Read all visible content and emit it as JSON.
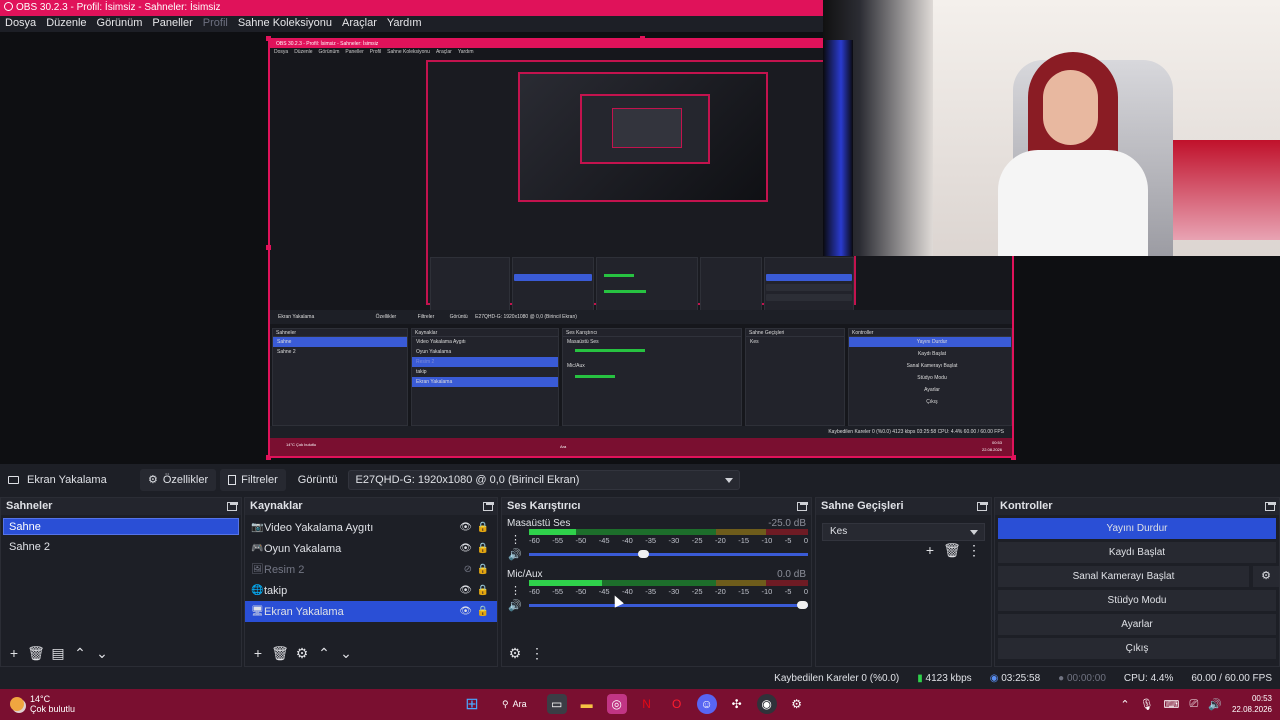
{
  "window": {
    "title": "OBS 30.2.3 - Profil: İsimsiz - Sahneler: İsimsiz"
  },
  "menu": [
    "Dosya",
    "Düzenle",
    "Görünüm",
    "Paneller",
    "Profil",
    "Sahne Koleksiyonu",
    "Araçlar",
    "Yardım"
  ],
  "nested": {
    "title": "OBS 30.2.3 - Profil: İsimsiz - Sahneler: İsimsiz",
    "source_name": "Ekran Yakalama",
    "props": "Özellikler",
    "filters": "Filtreler",
    "display_label": "Görüntü",
    "display_value": "E27QHD-G: 1920x1080 @ 0,0 (Birincil Ekran)",
    "scenes_head": "Sahneler",
    "scenes": [
      "Sahne",
      "Sahne 2"
    ],
    "sources_head": "Kaynaklar",
    "sources": [
      "Video Yakalama Aygıtı",
      "Oyun Yakalama",
      "Resim 2",
      "takip",
      "Ekran Yakalama"
    ],
    "mixer_head": "Ses Karıştırıcı",
    "mixer_ch1": "Masaüstü Ses",
    "mixer_ch1_db": "-25.0 dB",
    "mixer_ch2": "Mic/Aux",
    "mixer_ch2_db": "0.0 dB",
    "trans_head": "Sahne Geçişleri",
    "trans_value": "Kes",
    "ctrl_head": "Kontroller",
    "ctrls": [
      "Yayını Durdur",
      "Kaydı Başlat",
      "Sanal Kamerayı Başlat",
      "Stüdyo Modu",
      "Ayarlar",
      "Çıkış"
    ],
    "status": "Kaybedilen Kareler 0 (%0.0)   4123 kbps   03:25:58   CPU: 4.4%   60.00 / 60.00 FPS",
    "weather": "14°C Çok bulutlu",
    "search": "Ara",
    "clock": "00:53",
    "date": "22.08.2026"
  },
  "source_toolbar": {
    "source_name": "Ekran Yakalama",
    "properties_label": "Özellikler",
    "filters_label": "Filtreler",
    "display_label": "Görüntü",
    "display_value": "E27QHD-G: 1920x1080 @ 0,0 (Birincil Ekran)"
  },
  "scenes": {
    "title": "Sahneler",
    "items": [
      "Sahne",
      "Sahne 2"
    ],
    "selected": 0
  },
  "sources": {
    "title": "Kaynaklar",
    "items": [
      {
        "label": "Video Yakalama Aygıtı",
        "icon": "camera-icon",
        "visible": true,
        "selected": false
      },
      {
        "label": "Oyun Yakalama",
        "icon": "gamepad-icon",
        "visible": true,
        "selected": false
      },
      {
        "label": "Resim 2",
        "icon": "image-icon",
        "visible": false,
        "selected": false
      },
      {
        "label": "takip",
        "icon": "globe-icon",
        "visible": true,
        "selected": false
      },
      {
        "label": "Ekran Yakalama",
        "icon": "monitor-icon",
        "visible": true,
        "selected": true
      }
    ]
  },
  "mixer": {
    "title": "Ses Karıştırıcı",
    "scale": [
      "-60",
      "-55",
      "-50",
      "-45",
      "-40",
      "-35",
      "-30",
      "-25",
      "-20",
      "-15",
      "-10",
      "-5",
      "0"
    ],
    "channels": [
      {
        "name": "Masaüstü Ses",
        "db": "-25.0 dB",
        "level": 0.17,
        "volume": 0.43
      },
      {
        "name": "Mic/Aux",
        "db": "0.0 dB",
        "level": 0.26,
        "volume": 1.0
      }
    ]
  },
  "transitions": {
    "title": "Sahne Geçişleri",
    "value": "Kes"
  },
  "controls": {
    "title": "Kontroller",
    "stop_stream": "Yayını Durdur",
    "start_record": "Kaydı Başlat",
    "start_virtualcam": "Sanal Kamerayı Başlat",
    "studio_mode": "Stüdyo Modu",
    "settings": "Ayarlar",
    "exit": "Çıkış"
  },
  "status": {
    "dropped": "Kaybedilen Kareler 0 (%0.0)",
    "bitrate": "4123 kbps",
    "stream_time": "03:25:58",
    "record_time": "00:00:00",
    "cpu": "CPU: 4.4%",
    "fps": "60.00 / 60.00 FPS"
  },
  "taskbar": {
    "temp": "14°C",
    "weather": "Çok bulutlu",
    "search": "Ara",
    "time": "00:53",
    "date": "22.08.2026"
  },
  "colors": {
    "accent": "#2a4fd6",
    "brand": "#e0125a",
    "taskbar": "#7a0f30"
  }
}
